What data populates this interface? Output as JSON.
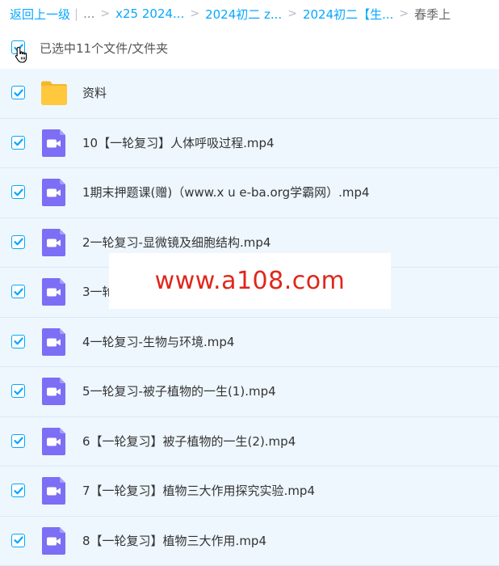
{
  "breadcrumb": {
    "back": "返回上一级",
    "ellipsis": "...",
    "items": [
      "x25 2024...",
      "2024初二 z...",
      "2024初二【生..."
    ],
    "current": "春季上"
  },
  "selection": {
    "text": "已选中11个文件/文件夹"
  },
  "files": [
    {
      "name": "资料",
      "type": "folder"
    },
    {
      "name": "10【一轮复习】人体呼吸过程.mp4",
      "type": "video"
    },
    {
      "name": "1期末押题课(赠)（www.x u e-ba.org学霸网）.mp4",
      "type": "video"
    },
    {
      "name": "2一轮复习-显微镜及细胞结构.mp4",
      "type": "video"
    },
    {
      "name": "3一轮复习-生物的特征.mp4",
      "type": "video"
    },
    {
      "name": "4一轮复习-生物与环境.mp4",
      "type": "video"
    },
    {
      "name": "5一轮复习-被子植物的一生(1).mp4",
      "type": "video"
    },
    {
      "name": "6【一轮复习】被子植物的一生(2).mp4",
      "type": "video"
    },
    {
      "name": "7【一轮复习】植物三大作用探究实验.mp4",
      "type": "video"
    },
    {
      "name": "8【一轮复习】植物三大作用.mp4",
      "type": "video"
    }
  ],
  "watermark": {
    "text": "www.a108.com"
  },
  "colors": {
    "accent": "#06a7ff",
    "row_selected": "#eef7fe",
    "video_icon": "#7c6ef5",
    "folder_icon": "#ffc83d",
    "watermark_text": "#e0261b"
  },
  "icons": {
    "checkbox": "checkmark-icon",
    "folder": "folder-icon",
    "video": "video-file-icon",
    "cursor": "hand-pointer-icon"
  }
}
